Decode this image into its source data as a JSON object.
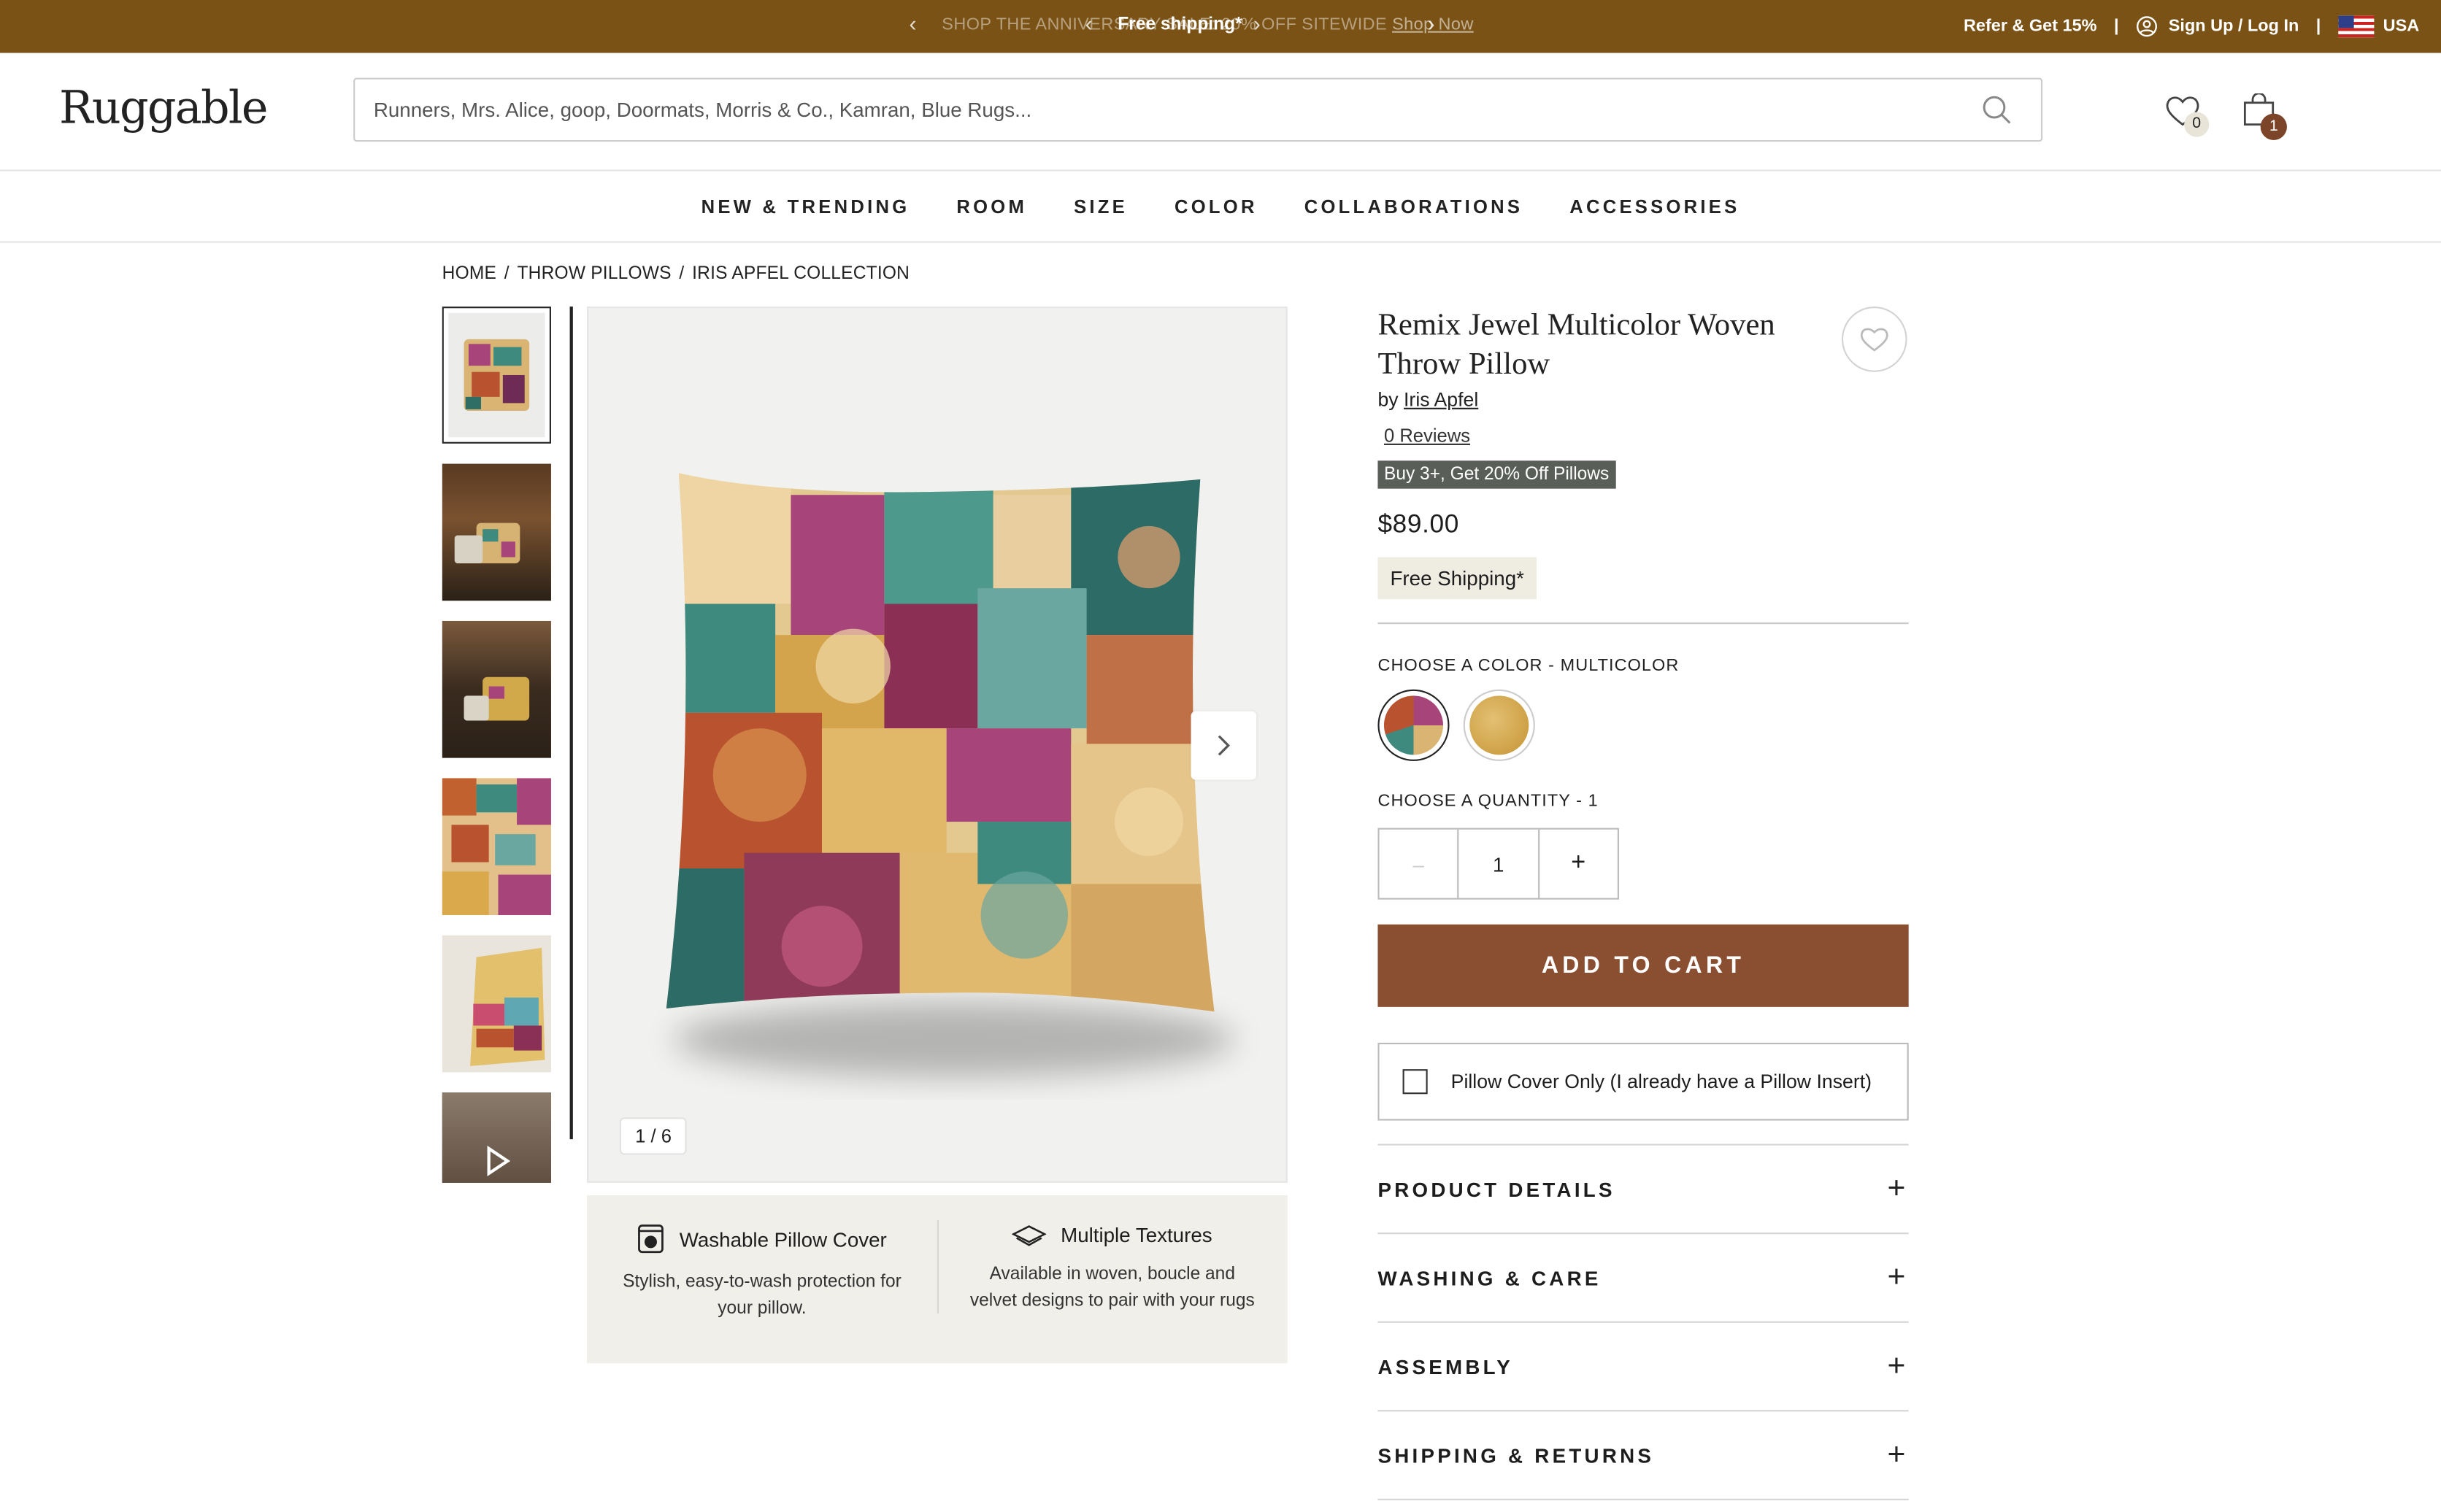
{
  "announcement": {
    "ghost_text": "SHOP THE ANNIVERSARY SALE: 20% OFF SITEWIDE",
    "ghost_link": "Shop Now",
    "main": "Free shipping*",
    "prev": "‹",
    "next": "›",
    "refer": "Refer & Get 15%",
    "separator": "|",
    "signup": "Sign Up / Log In",
    "country": "USA"
  },
  "header": {
    "logo": "Ruggable",
    "search_placeholder": "Runners, Mrs. Alice, goop, Doormats, Morris & Co., Kamran, Blue Rugs...",
    "wishlist_count": "0",
    "cart_count": "1"
  },
  "nav": [
    "NEW & TRENDING",
    "ROOM",
    "SIZE",
    "COLOR",
    "COLLABORATIONS",
    "ACCESSORIES"
  ],
  "breadcrumb": [
    "HOME",
    "THROW PILLOWS",
    "IRIS APFEL COLLECTION"
  ],
  "breadcrumb_sep": "/",
  "gallery": {
    "counter": "1 / 6",
    "thumb_count": 6,
    "active": 0
  },
  "features": [
    {
      "title": "Washable Pillow Cover",
      "desc": "Stylish, easy-to-wash protection for your pillow."
    },
    {
      "title": "Multiple Textures",
      "desc": "Available in woven, boucle and velvet designs to pair with your rugs"
    }
  ],
  "product": {
    "title": "Remix Jewel Multicolor Woven Throw Pillow",
    "by": "by",
    "brand": "Iris Apfel",
    "reviews": "0 Reviews",
    "promo": "Buy 3+, Get 20% Off Pillows",
    "price": "$89.00",
    "shipping": "Free Shipping*",
    "color_label": "CHOOSE A COLOR - MULTICOLOR",
    "quantity_label": "CHOOSE A QUANTITY - 1",
    "qty_minus": "–",
    "qty_value": "1",
    "qty_plus": "+",
    "add_to_cart": "ADD TO CART",
    "cover_only": "Pillow Cover Only (I already have a Pillow Insert)"
  },
  "accordion": [
    {
      "label": "PRODUCT DETAILS",
      "icon": "+"
    },
    {
      "label": "WASHING & CARE",
      "icon": "+"
    },
    {
      "label": "ASSEMBLY",
      "icon": "+"
    },
    {
      "label": "SHIPPING & RETURNS",
      "icon": "+"
    }
  ],
  "colors": {
    "announcement_bg": "#7a5215",
    "add_to_cart_bg": "#8a4e31",
    "promo_bg": "#595e58"
  }
}
